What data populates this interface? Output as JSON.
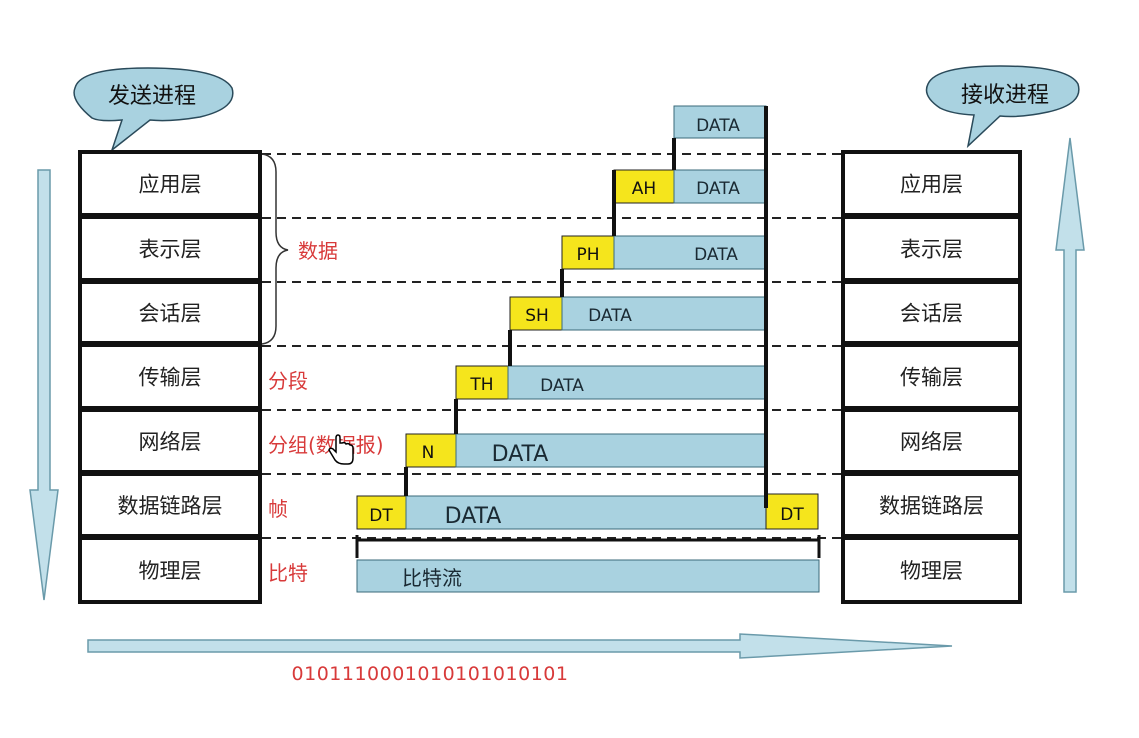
{
  "sender_label": "发送进程",
  "receiver_label": "接收进程",
  "layers": [
    "应用层",
    "表示层",
    "会话层",
    "传输层",
    "网络层",
    "数据链路层",
    "物理层"
  ],
  "units": {
    "data": "数据",
    "segment": "分段",
    "packet": "分组(数据报)",
    "frame": "帧",
    "bit": "比特"
  },
  "headers": {
    "application": "AH",
    "presentation": "PH",
    "session": "SH",
    "transport": "TH",
    "network": "N",
    "datalink_head": "DT",
    "datalink_tail": "DT"
  },
  "data_text": "DATA",
  "bitstream_label": "比特流",
  "binary_string": "0101110001010101010101",
  "colors": {
    "header_fill": "#f5e51c",
    "data_fill": "#a9d2e0",
    "bubble_fill": "#a9d2e0",
    "arrow_fill": "#c2e0ea",
    "unit_text": "#d83a3a",
    "line": "#111111"
  }
}
